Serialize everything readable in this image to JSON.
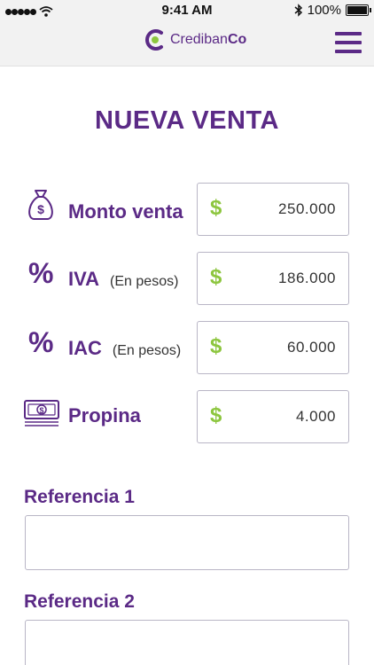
{
  "status_bar": {
    "time": "9:41 AM",
    "battery": "100%",
    "icons": [
      "signal-dots-icon",
      "wifi-icon",
      "bluetooth-icon",
      "battery-icon"
    ]
  },
  "header": {
    "logo_text_regular": "Crediban",
    "logo_text_bold": "Co",
    "menu_icon": "hamburger-menu-icon"
  },
  "page": {
    "title": "NUEVA VENTA"
  },
  "fields": [
    {
      "icon": "money-bag-icon",
      "label": "Monto venta",
      "sublabel": "",
      "currency": "$",
      "value": "250.000"
    },
    {
      "icon": "percent-icon",
      "icon_text": "%",
      "label": "IVA",
      "sublabel": "(En pesos)",
      "currency": "$",
      "value": "186.000"
    },
    {
      "icon": "percent-icon",
      "icon_text": "%",
      "label": "IAC",
      "sublabel": "(En pesos)",
      "currency": "$",
      "value": "60.000"
    },
    {
      "icon": "banknote-icon",
      "label": "Propina",
      "sublabel": "",
      "currency": "$",
      "value": "4.000"
    }
  ],
  "references": [
    {
      "label": "Referencia 1",
      "value": ""
    },
    {
      "label": "Referencia 2",
      "value": ""
    }
  ],
  "colors": {
    "brand_purple": "#5b2a86",
    "currency_green": "#8dc63f",
    "border": "#b9b6c6",
    "bar_background": "#f2f2f2"
  }
}
